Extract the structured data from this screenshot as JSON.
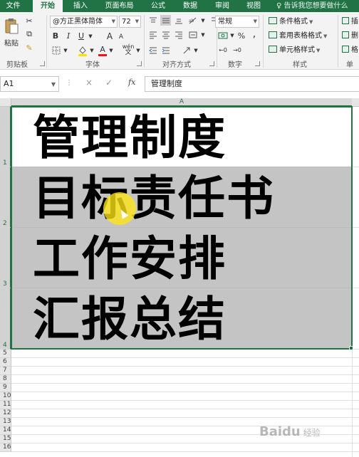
{
  "ribbon_tabs": [
    "文件",
    "开始",
    "插入",
    "页面布局",
    "公式",
    "数据",
    "审阅",
    "视图"
  ],
  "active_tab": "开始",
  "tell_me": "告诉我您想要做什么",
  "clipboard": {
    "paste": "粘贴",
    "label": "剪贴板"
  },
  "font": {
    "name": "@方正黑体简体",
    "size": "72",
    "label": "字体",
    "bold": "B",
    "italic": "I",
    "underline": "U",
    "grow": "A",
    "shrink": "A",
    "font_color": "A",
    "wen": "wén"
  },
  "alignment": {
    "label": "对齐方式"
  },
  "number": {
    "format": "常规",
    "label": "数字",
    "percent": "%",
    "comma": ","
  },
  "styles": {
    "label": "样式",
    "conditional": "条件格式",
    "table": "套用表格格式",
    "cell": "单元格样式"
  },
  "cells_group": {
    "label": "单",
    "insert": "插",
    "delete": "删",
    "format": "格"
  },
  "formula_bar": {
    "name_box": "A1",
    "fx": "fx",
    "content": "管理制度",
    "cancel": "×",
    "enter": "✓"
  },
  "column_header": "A",
  "rows": [
    {
      "num": "1",
      "text": "管理制度",
      "highlight": false
    },
    {
      "num": "2",
      "text": "目标责任书",
      "highlight": true
    },
    {
      "num": "3",
      "text": "工作安排",
      "highlight": true
    },
    {
      "num": "4",
      "text": "汇报总结",
      "highlight": true
    }
  ],
  "empty_rows": [
    "5",
    "6",
    "7",
    "8",
    "9",
    "10",
    "11",
    "12",
    "13",
    "14",
    "15",
    "16"
  ],
  "watermark": {
    "brand": "Baidu",
    "sub": "经验"
  },
  "colors": {
    "accent": "#217346",
    "highlight": "#c4c4c4",
    "cursor": "#ffe614"
  }
}
